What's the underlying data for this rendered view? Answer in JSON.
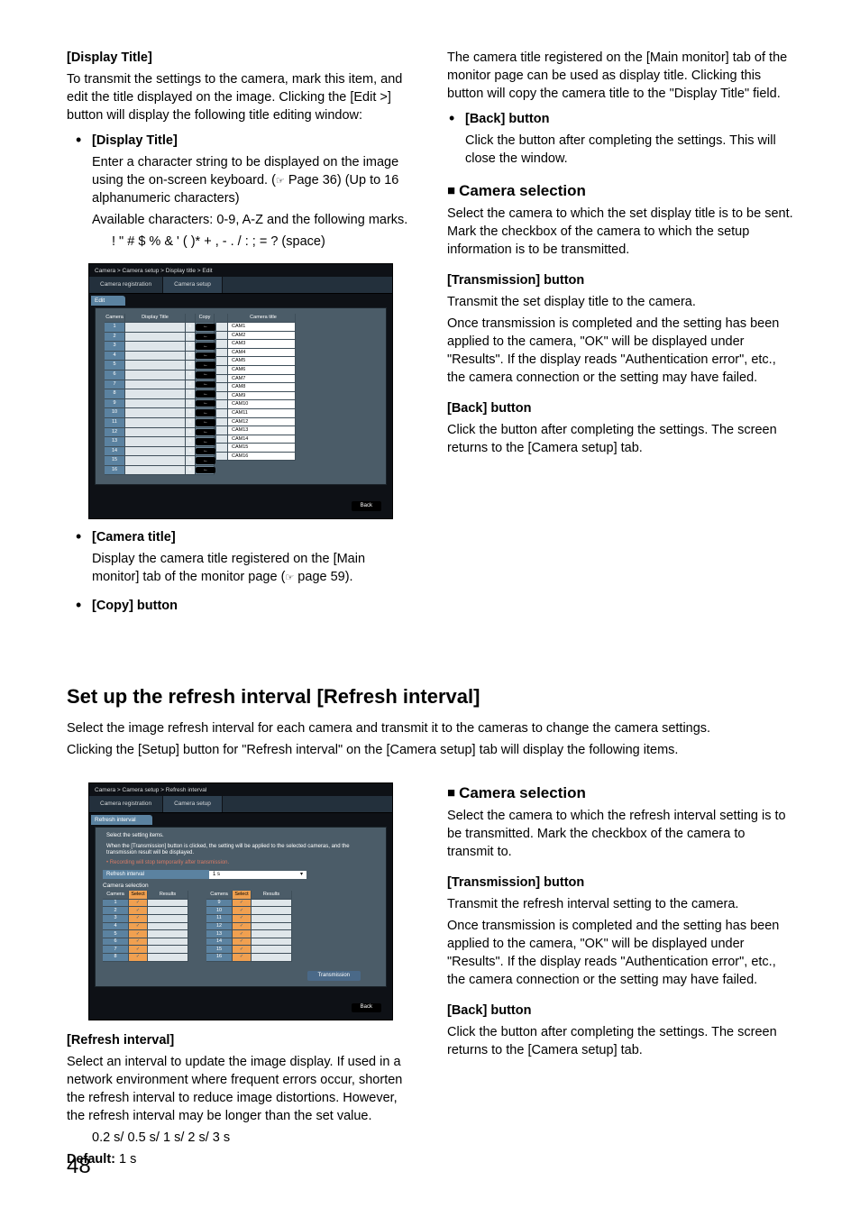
{
  "top": {
    "left": {
      "h1": "[Display Title]",
      "p1": "To transmit the settings to the camera, mark this item, and edit the title displayed on the image. Clicking the [Edit >] button will display the following title editing window:",
      "b1_head": "[Display Title]",
      "b1_l1": "Enter a character string to be displayed on the image using the on-screen keyboard. (",
      "b1_l1_ref": "☞",
      "b1_l1_b": " Page 36) (Up to 16 alphanumeric characters)",
      "b1_l2": "Available characters: 0-9, A-Z and the following marks.",
      "b1_l3": "! \" # $ % & ' ( )* + , - . / :  ; = ? (space)",
      "b2_head": "[Camera title]",
      "b2_l1a": "Display the camera title registered on the [Main monitor] tab of the monitor page (",
      "b2_l1_ref": "☞",
      "b2_l1b": " page 59).",
      "b3_head": "[Copy] button"
    },
    "right": {
      "p1": "The camera title registered on the [Main monitor] tab of the monitor page can be used as display title. Clicking this button will copy the camera title to the \"Display Title\" field.",
      "b1_head": "[Back] button",
      "b1_body": "Click the button after completing the settings. This will close the window.",
      "h2": "Camera selection",
      "p2": "Select the camera to which the set display title is to be sent. Mark the checkbox of the camera to which the setup information is to be transmitted.",
      "t1_head": "[Transmission] button",
      "t1_l1": "Transmit the set display title to the camera.",
      "t1_l2": "Once transmission is completed and the setting has been applied to the camera, \"OK\" will be displayed under \"Results\". If the display reads \"Authentication error\", etc., the camera connection or the setting may have failed.",
      "bk_head": "[Back] button",
      "bk_body": "Click the button after completing the settings. The screen returns to the [Camera setup] tab."
    },
    "shot": {
      "crumb": "Camera > Camera setup > Display title > Edit",
      "tab1": "Camera registration",
      "tab2": "Camera setup",
      "sect": "Edit",
      "hdr_cam": "Camera",
      "hdr_dt": "Display Title",
      "hdr_copy": "Copy",
      "hdr_ct": "Camera title",
      "back": "Back",
      "rows": [
        {
          "n": "1",
          "ct": "CAM1"
        },
        {
          "n": "2",
          "ct": "CAM2"
        },
        {
          "n": "3",
          "ct": "CAM3"
        },
        {
          "n": "4",
          "ct": "CAM4"
        },
        {
          "n": "5",
          "ct": "CAM5"
        },
        {
          "n": "6",
          "ct": "CAM6"
        },
        {
          "n": "7",
          "ct": "CAM7"
        },
        {
          "n": "8",
          "ct": "CAM8"
        },
        {
          "n": "9",
          "ct": "CAM9"
        },
        {
          "n": "10",
          "ct": "CAM10"
        },
        {
          "n": "11",
          "ct": "CAM11"
        },
        {
          "n": "12",
          "ct": "CAM12"
        },
        {
          "n": "13",
          "ct": "CAM13"
        },
        {
          "n": "14",
          "ct": "CAM14"
        },
        {
          "n": "15",
          "ct": "CAM15"
        },
        {
          "n": "16",
          "ct": "CAM16"
        }
      ]
    }
  },
  "bottom": {
    "title": "Set up the refresh interval [Refresh interval]",
    "intro1": "Select the image refresh interval for each camera and transmit it to the cameras to change the camera settings.",
    "intro2": "Clicking the [Setup] button for \"Refresh interval\" on the [Camera setup] tab will display the following items.",
    "left": {
      "h": "[Refresh interval]",
      "p1": "Select an interval to update the image display. If used in a network environment where frequent errors occur, shorten the refresh interval to reduce image distortions. However, the refresh interval may be longer than the set value.",
      "opts": "0.2 s/ 0.5 s/ 1 s/ 2 s/ 3 s",
      "def_label": "Default:",
      "def_val": " 1 s"
    },
    "right": {
      "h2": "Camera selection",
      "p2": "Select the camera to which the refresh interval setting is to be transmitted. Mark the checkbox of the camera to transmit to.",
      "t_head": "[Transmission] button",
      "t_l1": "Transmit the refresh interval setting to the camera.",
      "t_l2": "Once transmission is completed and the setting has been applied to the camera, \"OK\" will be displayed under \"Results\". If the display reads \"Authentication error\", etc., the camera connection or the setting may have failed.",
      "bk_head": "[Back] button",
      "bk_body": "Click the button after completing the settings. The screen returns to the [Camera setup] tab."
    },
    "shot": {
      "crumb": "Camera > Camera setup > Refresh interval",
      "tab1": "Camera registration",
      "tab2": "Camera setup",
      "sect": "Refresh interval",
      "inst1": "Select the setting items.",
      "inst2": "When the [Transmission]  button is clicked, the setting will be applied to the selected cameras, and the transmission result will be displayed.",
      "inst3": "Recording will stop temporarily after transmission.",
      "field_label": "Refresh interval",
      "field_value": "1 s",
      "camsel": "Camera selection",
      "hdr_cam": "Camera",
      "hdr_sel": "Select",
      "hdr_res": "Results",
      "tx": "Transmission",
      "back": "Back",
      "left_rows": [
        "1",
        "2",
        "3",
        "4",
        "5",
        "6",
        "7",
        "8"
      ],
      "right_rows": [
        "9",
        "10",
        "11",
        "12",
        "13",
        "14",
        "15",
        "16"
      ]
    }
  },
  "page": "48"
}
